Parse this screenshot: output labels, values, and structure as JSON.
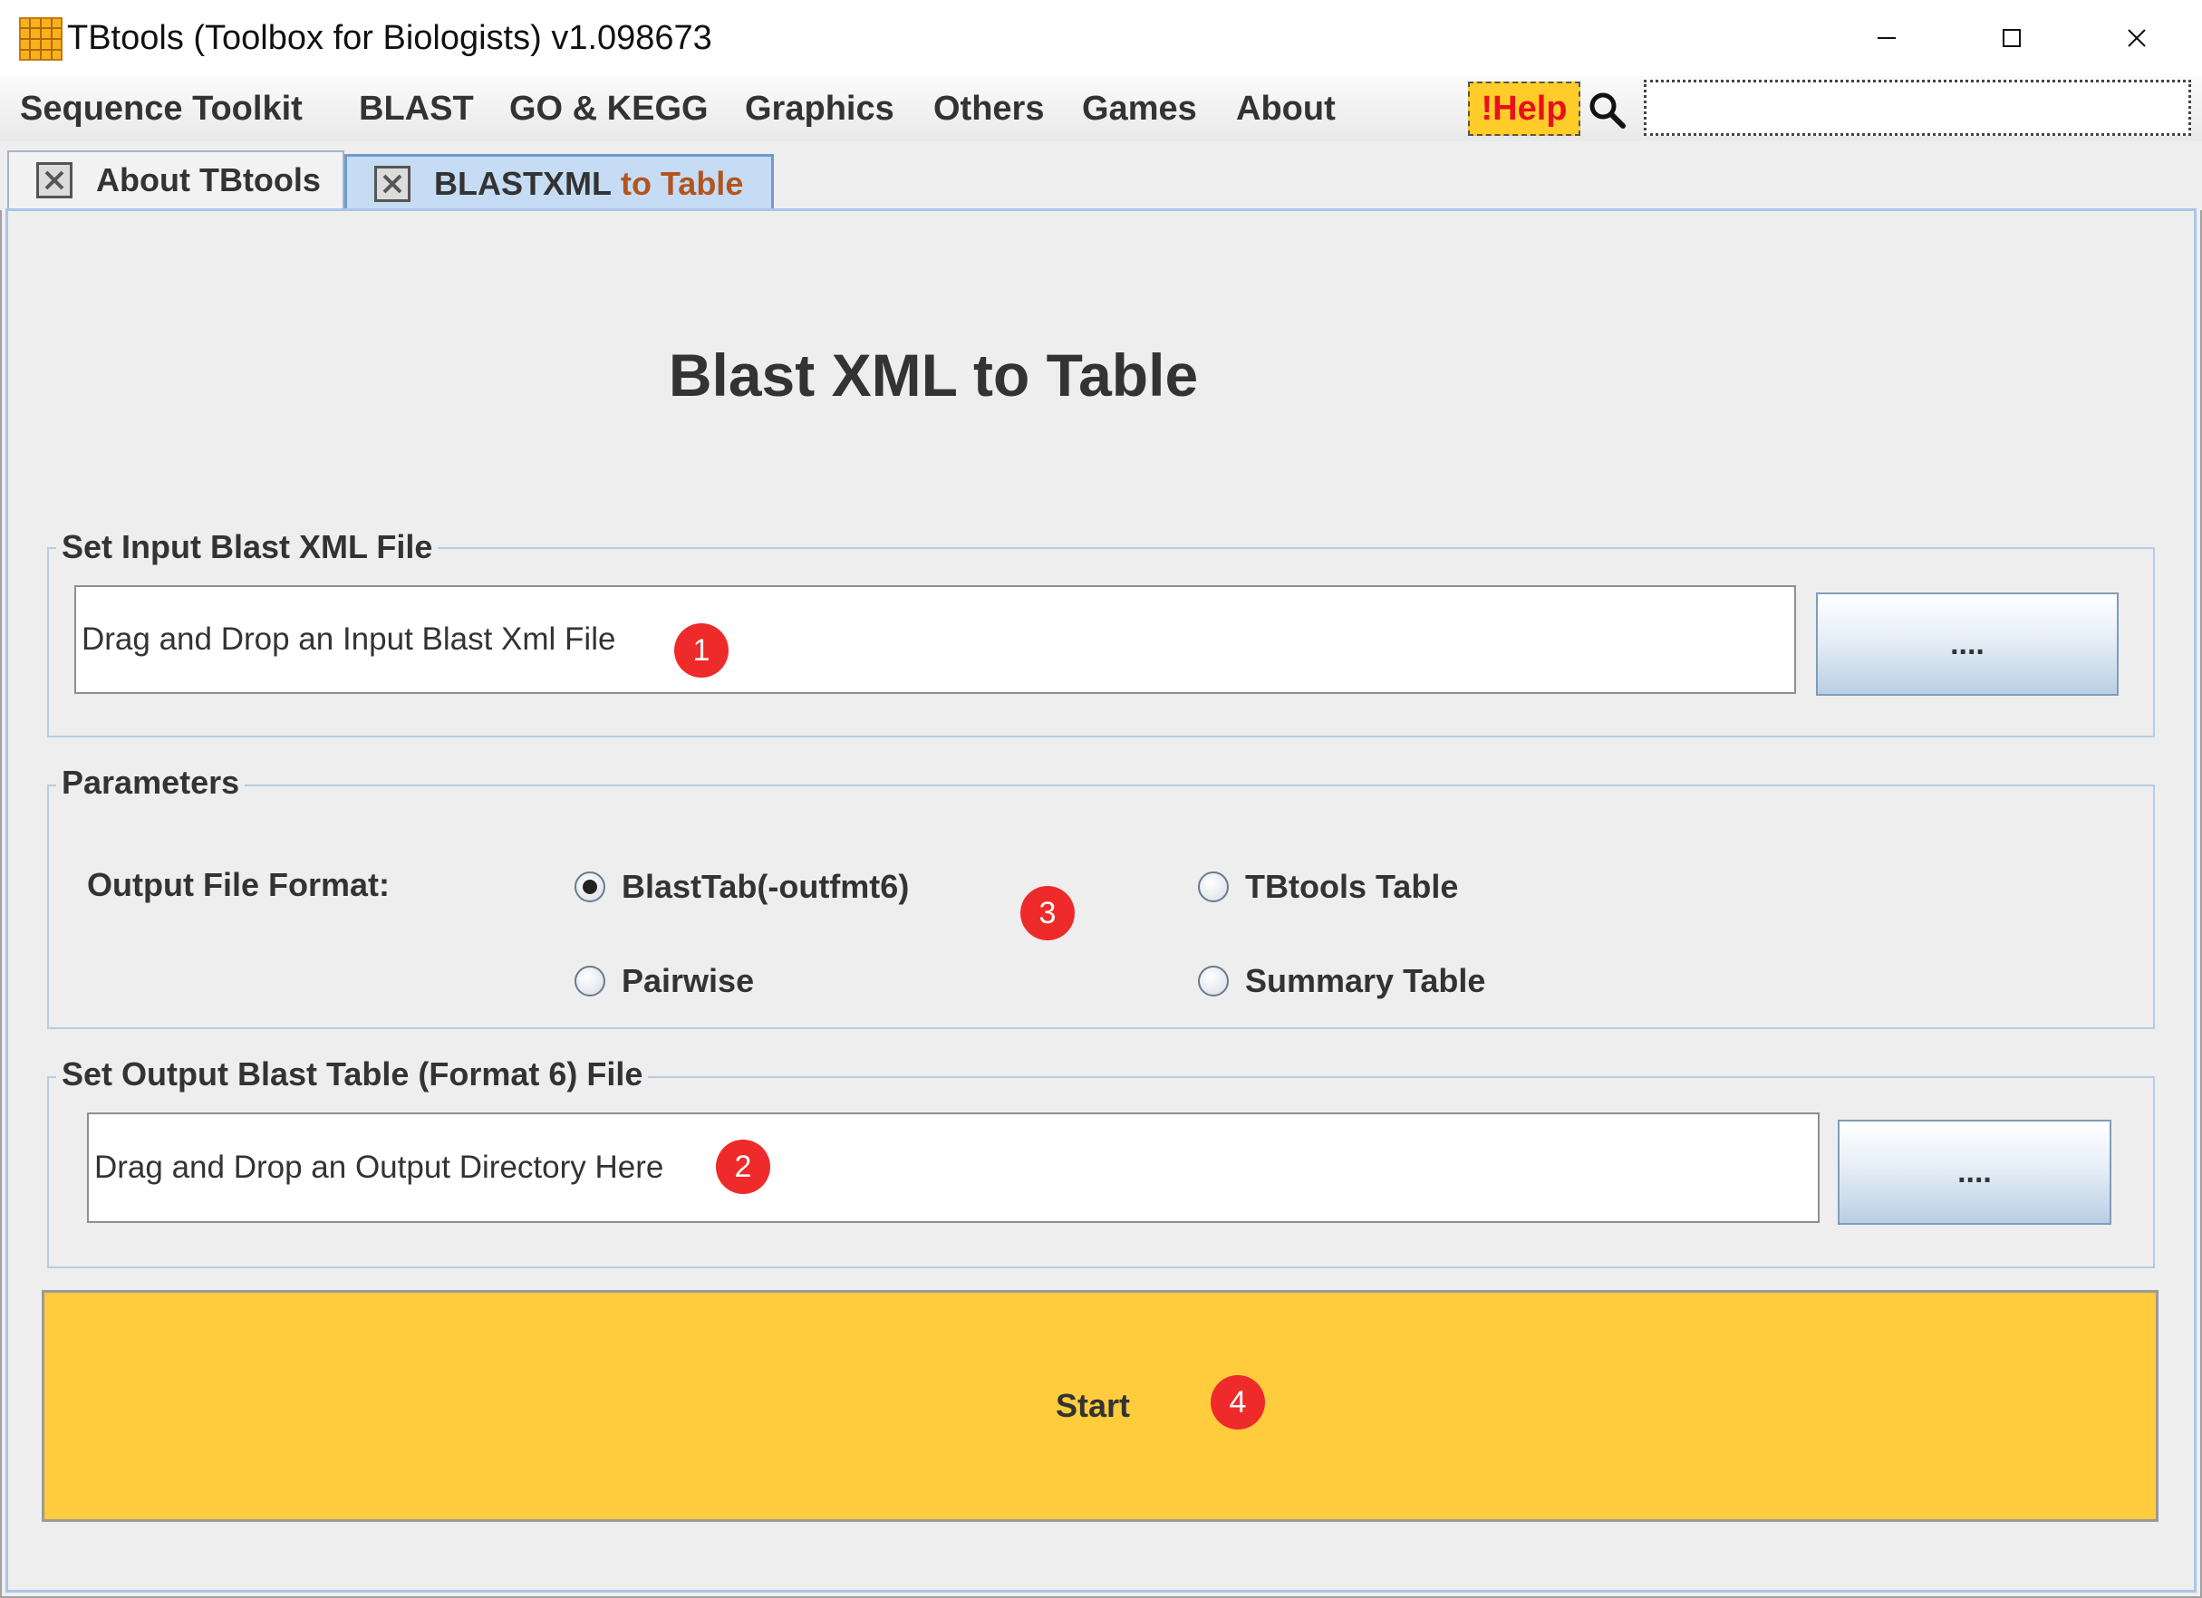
{
  "window": {
    "title": "TBtools (Toolbox for Biologists) v1.098673"
  },
  "menu": {
    "items": [
      "Sequence Toolkit",
      "BLAST",
      "GO & KEGG",
      "Graphics",
      "Others",
      "Games",
      "About"
    ],
    "help_label": "!Help",
    "search_value": ""
  },
  "tabs": [
    {
      "label": "About TBtools",
      "active": false
    },
    {
      "label_part1": "BLASTXML",
      "label_part2": "to Table",
      "active": true
    }
  ],
  "page": {
    "title": "Blast XML to Table"
  },
  "input_group": {
    "title": "Set Input Blast XML File",
    "field_text": "Drag and Drop an Input Blast Xml File",
    "browse_label": "...."
  },
  "params_group": {
    "title": "Parameters",
    "format_label": "Output File Format:",
    "options": [
      {
        "label": "BlastTab(-outfmt6)",
        "selected": true
      },
      {
        "label": "Pairwise",
        "selected": false
      },
      {
        "label": "TBtools Table",
        "selected": false
      },
      {
        "label": "Summary Table",
        "selected": false
      }
    ]
  },
  "output_group": {
    "title": "Set Output Blast Table (Format 6) File",
    "field_text": "Drag and Drop an Output Directory Here",
    "browse_label": "...."
  },
  "start": {
    "label": "Start"
  },
  "badges": [
    "1",
    "2",
    "3",
    "4"
  ],
  "colors": {
    "start_button": "#ffcc3d",
    "help_background": "#ffcc2a",
    "help_text": "#e8101a",
    "active_tab": "#c6dcf4",
    "badge": "#ee2a2a",
    "group_border": "#b8cce4"
  },
  "icons": {
    "app": "tbtools-grid-logo-icon",
    "search": "magnifier-icon",
    "tab_close": "close-x-icon"
  }
}
